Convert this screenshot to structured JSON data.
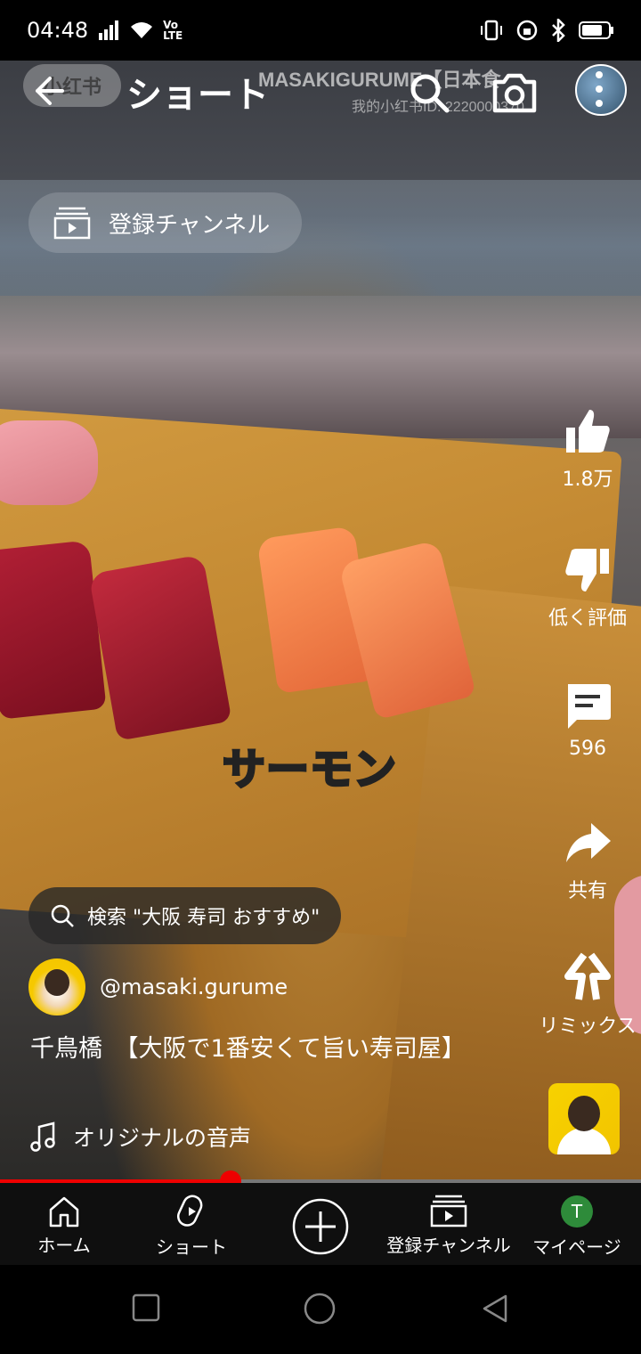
{
  "status_bar": {
    "time": "04:48",
    "volte": "Vo\nLTE"
  },
  "video_overlay": {
    "watermark_logo": "小红书",
    "watermark_name": "MASAKIGURUME【日本食",
    "watermark_id": "我的小红书ID: 2220000370",
    "caption": "サーモン"
  },
  "header": {
    "title": "ショート"
  },
  "subscriptions_chip": {
    "label": "登録チャンネル"
  },
  "actions": {
    "like_count": "1.8万",
    "dislike_label": "低く評価",
    "comment_count": "596",
    "share_label": "共有",
    "remix_label": "リミックス"
  },
  "search_suggestion": {
    "text": "検索 \"大阪 寿司 おすすめ\""
  },
  "channel": {
    "handle": "@masaki.gurume"
  },
  "video": {
    "title": "千鳥橋　【大阪で1番安くて旨い寿司屋】",
    "audio": "オリジナルの音声",
    "progress": 0.36
  },
  "bottom_nav": {
    "home": "ホーム",
    "shorts": "ショート",
    "subscriptions": "登録チャンネル",
    "mypage": "マイページ",
    "avatar_letter": "T"
  },
  "colors": {
    "accent": "#e00000",
    "nav_bg": "#0f0f0f",
    "avatar": "#2e8b3a"
  }
}
